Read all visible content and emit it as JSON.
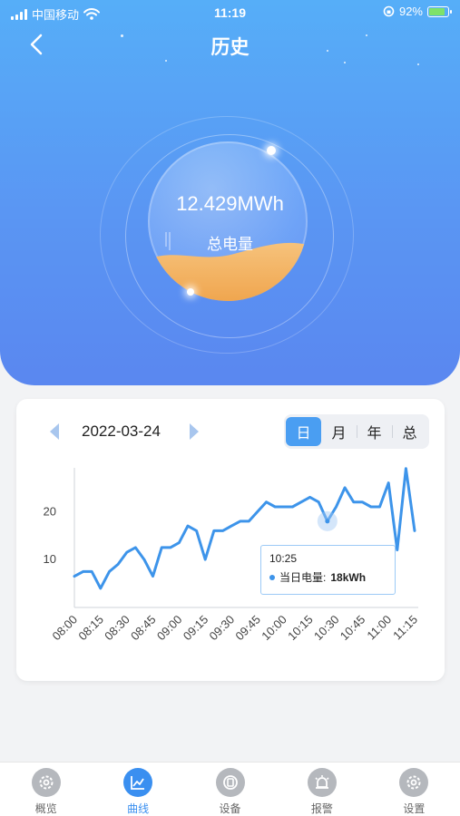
{
  "status_bar": {
    "carrier": "中国移动",
    "time": "11:19",
    "battery": "92%",
    "battery_level": 0.92
  },
  "header": {
    "title": "历史",
    "back_icon": "chevron-left-icon"
  },
  "summary": {
    "total_energy": "12.429MWh",
    "total_label": "总电量"
  },
  "chart_card": {
    "date": "2022-03-24",
    "periods": [
      "日",
      "月",
      "年",
      "总"
    ],
    "active_period": "日"
  },
  "chart_data": {
    "type": "line",
    "title": "",
    "xlabel": "",
    "ylabel": "",
    "ylim": [
      0,
      28
    ],
    "yticks": [
      10,
      20
    ],
    "categories": [
      "08:00",
      "08:05",
      "08:10",
      "08:15",
      "08:20",
      "08:25",
      "08:30",
      "08:35",
      "08:40",
      "08:45",
      "08:50",
      "08:55",
      "09:00",
      "09:05",
      "09:10",
      "09:15",
      "09:20",
      "09:25",
      "09:30",
      "09:35",
      "09:40",
      "09:45",
      "09:50",
      "09:55",
      "10:00",
      "10:05",
      "10:10",
      "10:15",
      "10:20",
      "10:25",
      "10:30",
      "10:35",
      "10:40",
      "10:45",
      "10:50",
      "10:55",
      "11:00",
      "11:05",
      "11:10",
      "11:15"
    ],
    "xtick_labels": [
      "08:00",
      "08:15",
      "08:30",
      "08:45",
      "09:00",
      "09:15",
      "09:30",
      "09:45",
      "10:00",
      "10:15",
      "10:30",
      "10:45",
      "11:00",
      "11:15"
    ],
    "series": [
      {
        "values": [
          6.5,
          7.5,
          7.5,
          4.0,
          7.5,
          9.0,
          11.5,
          12.5,
          10.0,
          6.5,
          12.5,
          12.5,
          13.5,
          17.0,
          16.0,
          10.0,
          16.0,
          16.0,
          17.0,
          18.0,
          18.0,
          20.0,
          22.0,
          21.0,
          21.0,
          21.0,
          22.0,
          23.0,
          22.0,
          18.0,
          21.0,
          25.0,
          22.0,
          22.0,
          21.0,
          21.0,
          26.0,
          12.0,
          29.0,
          16.0
        ]
      }
    ],
    "highlight": {
      "category": "10:25",
      "value": 18
    },
    "grid": false,
    "line_color": "#3d94ea"
  },
  "tooltip": {
    "time": "10:25",
    "label": "当日电量:",
    "value": "18kWh"
  },
  "tabbar": {
    "items": [
      {
        "label": "概览",
        "icon": "gear-icon",
        "active": false
      },
      {
        "label": "曲线",
        "icon": "line-chart-icon",
        "active": true
      },
      {
        "label": "设备",
        "icon": "device-icon",
        "active": false
      },
      {
        "label": "报警",
        "icon": "alarm-light-icon",
        "active": false
      },
      {
        "label": "设置",
        "icon": "settings-icon",
        "active": false
      }
    ]
  }
}
